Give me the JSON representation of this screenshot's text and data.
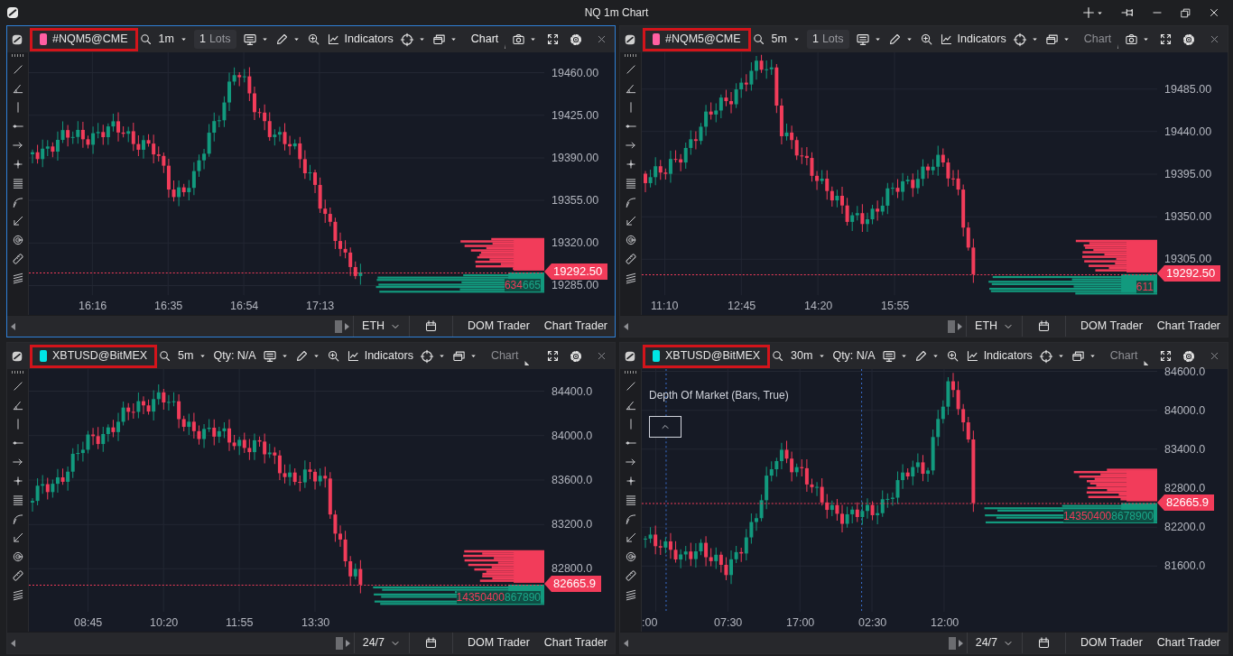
{
  "window": {
    "title": "NQ 1m Chart"
  },
  "panels": [
    {
      "active": true,
      "highlighted": true,
      "symbol": "#NQM5@CME",
      "color": "#ff5fa2",
      "interval": "1m",
      "quantity": {
        "kind": "lots",
        "value": "1",
        "unit": "Lots"
      },
      "indicators": "Indicators",
      "chart_label": "Chart",
      "screenshot_button": true,
      "price_ticks": [
        "19460.00",
        "19425.00",
        "19390.00",
        "19355.00",
        "19320.00",
        "19285.00"
      ],
      "last_price": "19292.50",
      "time_ticks": [
        "16:16",
        "16:35",
        "16:54",
        "17:13"
      ],
      "dom_volume": [
        {
          "text": "634",
          "kind": "ask"
        },
        {
          "text": "665",
          "kind": "bid"
        }
      ],
      "session": "ETH",
      "buttons": [
        "DOM Trader",
        "Chart Trader"
      ]
    },
    {
      "active": false,
      "highlighted": true,
      "symbol": "#NQM5@CME",
      "color": "#ff5fa2",
      "interval": "5m",
      "quantity": {
        "kind": "lots",
        "value": "1",
        "unit": "Lots"
      },
      "indicators": "Indicators",
      "chart_label": "Chart",
      "screenshot_button": true,
      "price_ticks": [
        "19485.00",
        "19440.00",
        "19395.00",
        "19350.00",
        "19305.00"
      ],
      "last_price": "19292.50",
      "time_ticks": [
        "11:10",
        "12:45",
        "14:20",
        "15:55"
      ],
      "dom_volume": [
        {
          "text": "611",
          "kind": "ask"
        }
      ],
      "session": "ETH",
      "buttons": [
        "DOM Trader",
        "Chart Trader"
      ]
    },
    {
      "active": false,
      "highlighted": true,
      "symbol": "XBTUSD@BitMEX",
      "color": "#00e5e5",
      "interval": "5m",
      "quantity": {
        "kind": "text",
        "label": "Qty: N/A"
      },
      "indicators": "Indicators",
      "chart_label": "Chart",
      "screenshot_button": false,
      "price_ticks": [
        "84400.0",
        "84000.0",
        "83600.0",
        "83200.0",
        "82800.0"
      ],
      "last_price": "82665.9",
      "time_ticks": [
        "08:45",
        "10:20",
        "11:55",
        "13:30"
      ],
      "dom_volume": [
        {
          "text": "14350400",
          "kind": "ask"
        },
        {
          "text": "867890",
          "kind": "bid"
        }
      ],
      "session": "24/7",
      "buttons": [
        "DOM Trader",
        "Chart Trader"
      ]
    },
    {
      "active": false,
      "highlighted": true,
      "symbol": "XBTUSD@BitMEX",
      "color": "#00e5e5",
      "interval": "30m",
      "quantity": {
        "kind": "text",
        "label": "Qty: N/A"
      },
      "indicators": "Indicators",
      "chart_label": "Chart",
      "screenshot_button": false,
      "legend": "Depth Of Market (Bars, True)",
      "collapse_button": true,
      "price_ticks": [
        "84600.0",
        "84000.0",
        "83400.0",
        "82800.0",
        "82200.0",
        "81600.0"
      ],
      "last_price": "82665.9",
      "time_ticks": [
        ":00",
        "07:30",
        "17:00",
        "02:30",
        "12:00"
      ],
      "dom_volume": [
        {
          "text": "14350400",
          "kind": "ask"
        },
        {
          "text": "8678900",
          "kind": "bid"
        }
      ],
      "session": "24/7",
      "buttons": [
        "DOM Trader",
        "Chart Trader"
      ]
    }
  ]
}
